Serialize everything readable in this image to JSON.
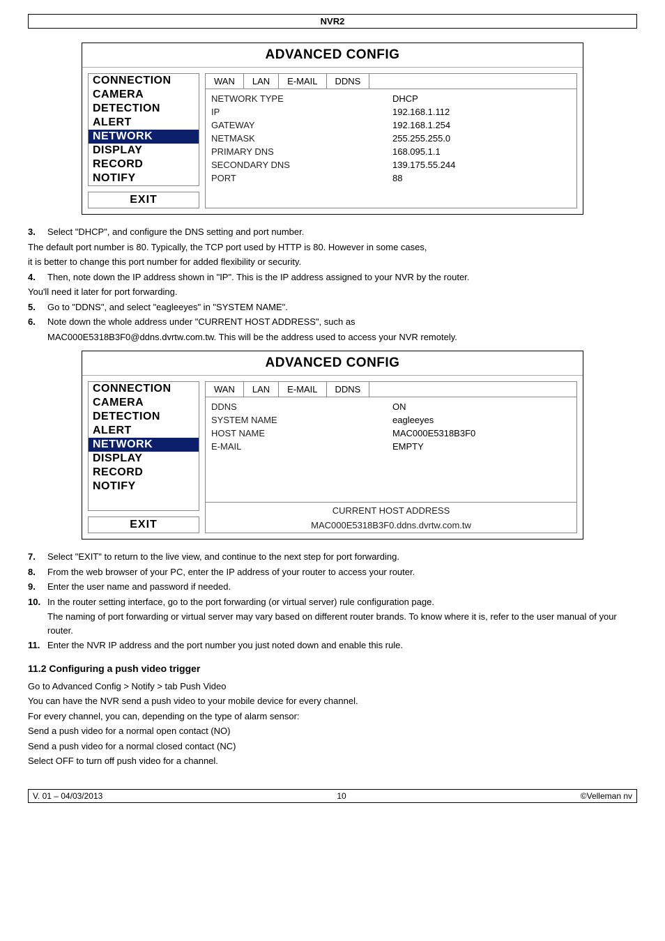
{
  "header": "NVR2",
  "panel1": {
    "title": "ADVANCED CONFIG",
    "sidebar": [
      "CONNECTION",
      "CAMERA",
      "DETECTION",
      "ALERT",
      "NETWORK",
      "DISPLAY",
      "RECORD",
      "NOTIFY"
    ],
    "selected": "NETWORK",
    "exit": "EXIT",
    "tabs": [
      "WAN",
      "LAN",
      "E-MAIL",
      "DDNS"
    ],
    "rows": [
      {
        "label": "NETWORK TYPE",
        "value": "DHCP"
      },
      {
        "label": "IP",
        "value": "192.168.1.112"
      },
      {
        "label": "GATEWAY",
        "value": "192.168.1.254"
      },
      {
        "label": "NETMASK",
        "value": "255.255.255.0"
      },
      {
        "label": "PRIMARY DNS",
        "value": "168.095.1.1"
      },
      {
        "label": "SECONDARY DNS",
        "value": "139.175.55.244"
      },
      {
        "label": "PORT",
        "value": "88"
      }
    ]
  },
  "steps_a": {
    "s3_num": "3.",
    "s3": "Select \"DHCP\", and configure the DNS setting and port number.",
    "s3b": "The default port number is 80. Typically, the TCP port used by HTTP is 80. However in some cases,",
    "s3c": "it is better to change this port number for added flexibility or security.",
    "s4_num": "4.",
    "s4": "Then, note down the IP address shown in \"IP\". This is the IP address assigned to your NVR by the router.",
    "s4b": "You'll need it later for port forwarding.",
    "s5_num": "5.",
    "s5": "Go to \"DDNS\", and select \"eagleeyes\" in \"SYSTEM NAME\".",
    "s6_num": "6.",
    "s6": "Note down the whole address under \"CURRENT HOST ADDRESS\", such as",
    "s6b": "MAC000E5318B3F0@ddns.dvrtw.com.tw. This will be the address used to access your NVR remotely."
  },
  "panel2": {
    "title": "ADVANCED CONFIG",
    "sidebar": [
      "CONNECTION",
      "CAMERA",
      "DETECTION",
      "ALERT",
      "NETWORK",
      "DISPLAY",
      "RECORD",
      "NOTIFY"
    ],
    "selected": "NETWORK",
    "exit": "EXIT",
    "tabs": [
      "WAN",
      "LAN",
      "E-MAIL",
      "DDNS"
    ],
    "rows": [
      {
        "label": "DDNS",
        "value": "ON"
      },
      {
        "label": "SYSTEM NAME",
        "value": "eagleeyes"
      },
      {
        "label": "HOST NAME",
        "value": "MAC000E5318B3F0"
      },
      {
        "label": "E-MAIL",
        "value": "EMPTY"
      }
    ],
    "footer_label": "CURRENT HOST ADDRESS",
    "footer_value": "MAC000E5318B3F0.ddns.dvrtw.com.tw"
  },
  "steps_b": {
    "s7_num": "7.",
    "s7": "Select \"EXIT\" to return to the live view, and continue to the next step for port forwarding.",
    "s8_num": "8.",
    "s8": "From the web browser of your PC, enter the IP address of your router to access your router.",
    "s9_num": "9.",
    "s9": "Enter the user name and password if needed.",
    "s10_num": "10.",
    "s10": "In the router setting interface, go to the port forwarding (or virtual server) rule configuration page.",
    "s10b": "The naming of port forwarding or virtual server may vary based on different router brands. To know where it is, refer to the user manual of your router.",
    "s11_num": "11.",
    "s11": "Enter the NVR IP address and the port number you just noted down and enable this rule."
  },
  "section": {
    "heading": "11.2   Configuring a push video trigger",
    "p1": "Go to Advanced Config > Notify > tab Push Video",
    "p2": "You can have the NVR send a push video to your mobile device for every channel.",
    "p3": "For every channel, you can, depending on the type of alarm sensor:",
    "p4": "Send a push video for a normal open contact (NO)",
    "p5": "Send a push video for a normal closed contact (NC)",
    "p6": "Select OFF to turn off push video for a channel."
  },
  "footer": {
    "left": "V. 01 – 04/03/2013",
    "center": "10",
    "right": "©Velleman nv"
  }
}
